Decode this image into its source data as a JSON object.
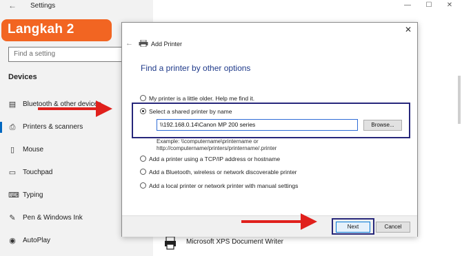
{
  "settings": {
    "title": "Settings",
    "search_placeholder": "Find a setting",
    "section": "Devices",
    "nav": [
      {
        "label": "Bluetooth & other devices",
        "icon": "bluetooth-devices-icon"
      },
      {
        "label": "Printers & scanners",
        "icon": "printer-icon"
      },
      {
        "label": "Mouse",
        "icon": "mouse-icon"
      },
      {
        "label": "Touchpad",
        "icon": "touchpad-icon"
      },
      {
        "label": "Typing",
        "icon": "keyboard-icon"
      },
      {
        "label": "Pen & Windows Ink",
        "icon": "pen-icon"
      },
      {
        "label": "AutoPlay",
        "icon": "autoplay-icon"
      }
    ],
    "active_index": 1
  },
  "banner": {
    "text": "Langkah 2",
    "color": "#f26522"
  },
  "dialog": {
    "header_title": "Add Printer",
    "heading": "Find a printer by other options",
    "options": [
      "My printer is a little older. Help me find it.",
      "Select a shared printer by name",
      "Add a printer using a TCP/IP address or hostname",
      "Add a Bluetooth, wireless or network discoverable printer",
      "Add a local printer or network printer with manual settings"
    ],
    "selected_option": 1,
    "path_value": "\\\\192.168.0.14\\Canon MP 200 series",
    "browse_label": "Browse...",
    "example_line1": "Example: \\\\computername\\printername or",
    "example_line2": "http://computername/printers/printername/.printer",
    "next_label": "Next",
    "cancel_label": "Cancel"
  },
  "background_printer": "Microsoft XPS Document Writer",
  "colors": {
    "highlight_border": "#26267a",
    "arrow": "#e0201c",
    "accent": "#0067c0"
  }
}
